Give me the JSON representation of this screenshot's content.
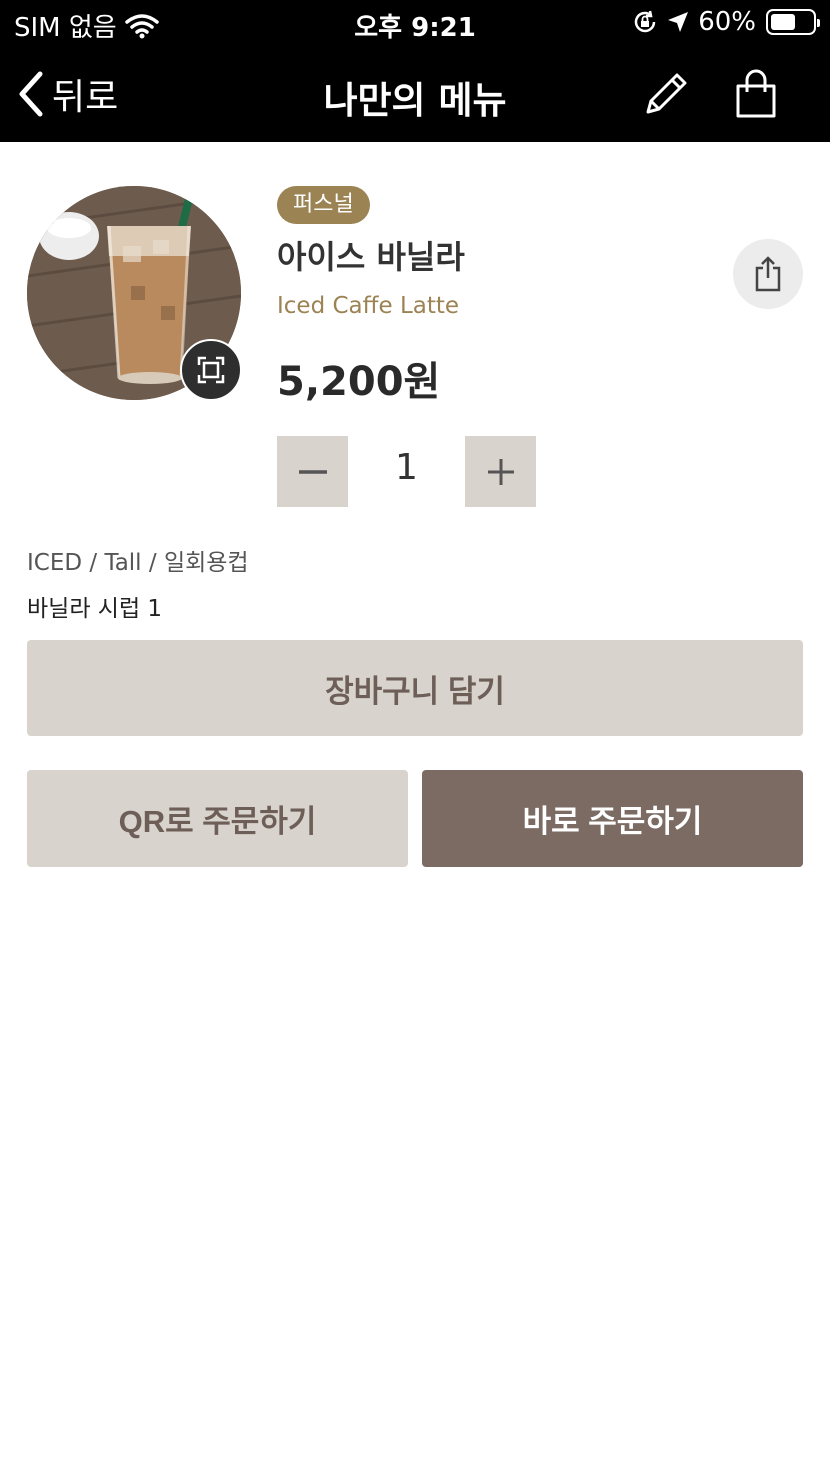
{
  "status_bar": {
    "carrier": "SIM 없음",
    "time": "오후 9:21",
    "battery": "60%",
    "battery_level": 0.6
  },
  "nav": {
    "back_label": "뒤로",
    "title": "나만의 메뉴"
  },
  "product": {
    "badge": "퍼스널",
    "name": "아이스 바닐라",
    "name_en": "Iced Caffe Latte",
    "price": "5,200원",
    "quantity": "1",
    "options": "ICED / Tall / 일회용컵",
    "extras": "바닐라 시럽 1"
  },
  "actions": {
    "add_to_cart": "장바구니 담기",
    "qr_order": "QR로 주문하기",
    "direct_order": "바로 주문하기"
  },
  "icons": {
    "back": "chevron-left-icon",
    "edit": "pencil-icon",
    "cart": "shopping-bag-icon",
    "zoom": "expand-icon",
    "share": "share-icon",
    "minus": "minus-icon",
    "plus": "plus-icon",
    "wifi": "wifi-icon",
    "location": "location-arrow-icon",
    "lock": "rotation-lock-icon"
  },
  "colors": {
    "accent": "#9b8354",
    "button_light": "#d9d3cd",
    "button_dark": "#7b6b63",
    "nav_bg": "#000000"
  }
}
